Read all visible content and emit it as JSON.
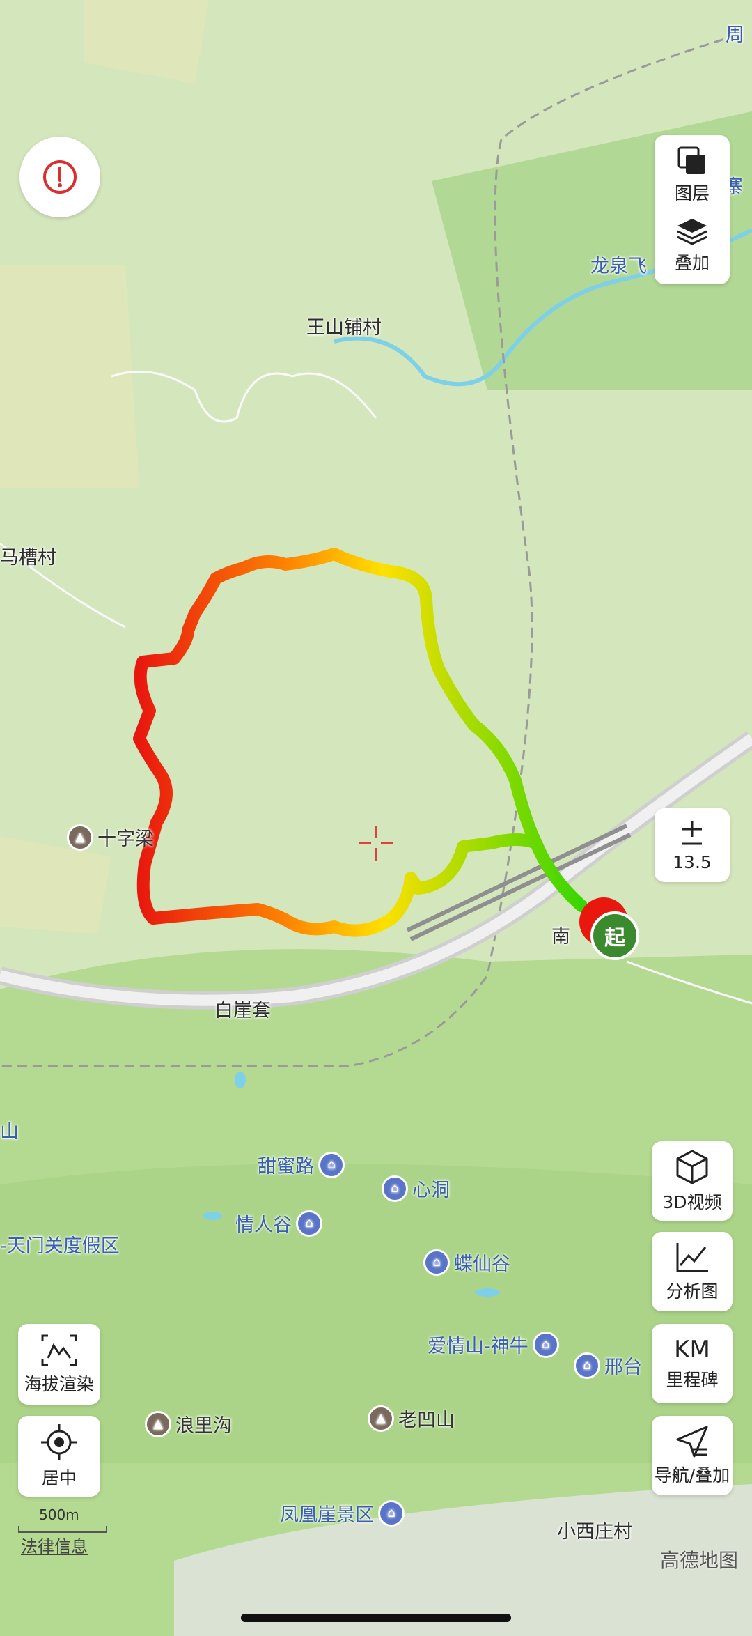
{
  "map_labels": {
    "zhou": "周",
    "wangshanpu": "王山铺村",
    "macao": "马槽村",
    "shizi": "十字梁",
    "baiya": "白崖套",
    "nan": "南",
    "longquan": "龙泉飞",
    "sai": "寨",
    "shan": "山",
    "tiantian": "甜蜜路",
    "xindong": "心洞",
    "qingrengu": "情人谷",
    "tianmen": "-天门关度假区",
    "diexiangu": "蝶仙谷",
    "aiqingshan": "爱情山-神牛",
    "xingtai": "邢台",
    "langligou": "浪里沟",
    "laoaoshan": "老凹山",
    "fenghuangya": "凤凰崖景区",
    "xiaoxizhuang": "小西庄村"
  },
  "controls": {
    "layers_label": "图层",
    "overlay_label": "叠加",
    "zoom_level": "13.5",
    "video3d_label": "3D视频",
    "analysis_label": "分析图",
    "km_label": "KM",
    "milestone_label": "里程碑",
    "nav_label": "导航/叠加",
    "elevation_label": "海拔渲染",
    "center_label": "居中",
    "start_label": "起"
  },
  "footer": {
    "scale": "500m",
    "legal": "法律信息",
    "brand": "高德地图"
  },
  "colors": {
    "track_low": "#39d600",
    "track_mid": "#ffe000",
    "track_high": "#e8180f",
    "start_marker": "#3c8a2e",
    "river": "#7ed0e8",
    "poi_blue": "#5a74c8"
  }
}
